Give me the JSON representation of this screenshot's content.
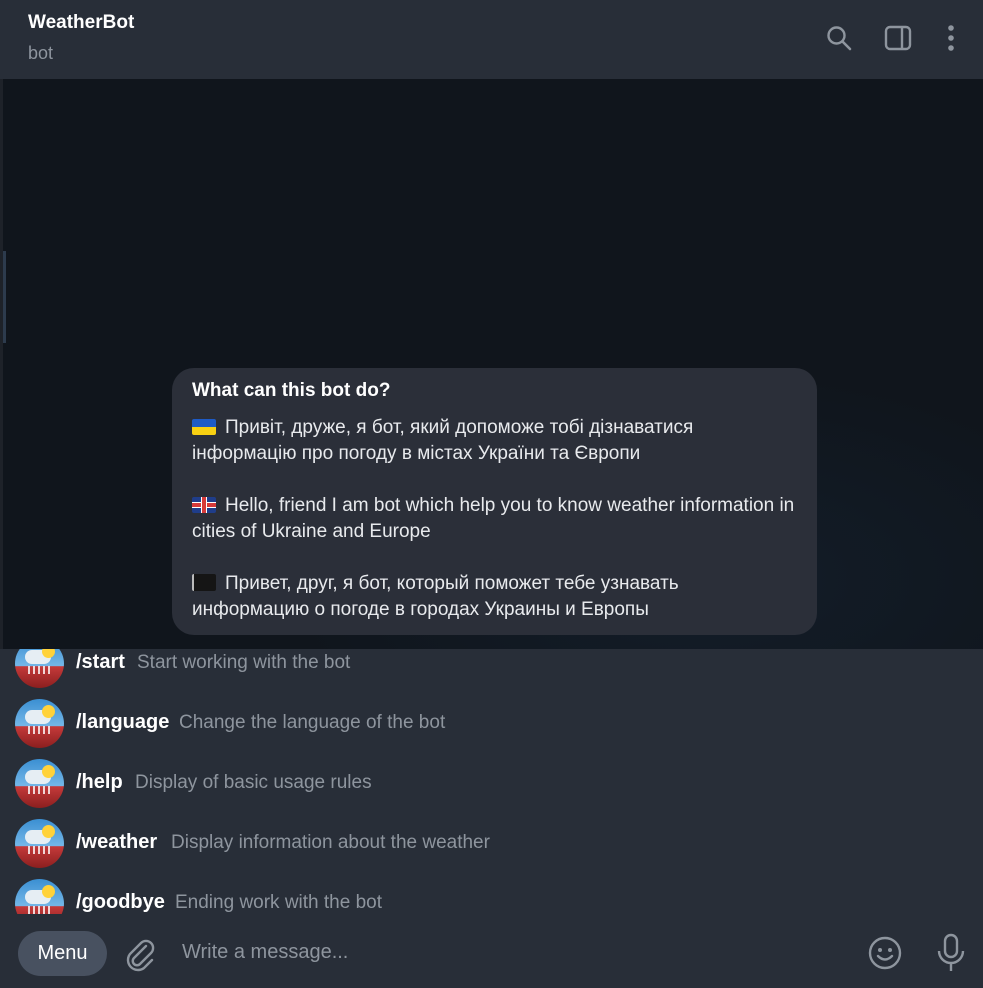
{
  "header": {
    "title": "WeatherBot",
    "subtitle": "bot",
    "icons": [
      "search-icon",
      "sidebar-toggle-icon",
      "more-vertical-icon"
    ]
  },
  "info_card": {
    "title": "What can this bot do?",
    "paragraphs": [
      {
        "flag": "ukraine-flag",
        "text": "Привіт, друже, я бот, який допоможе тобі дізнаватися інформацію про погоду в містах України та Європи"
      },
      {
        "flag": "uk-flag",
        "text": "Hello, friend I am bot which help you to know weather information in cities of Ukraine and Europe"
      },
      {
        "flag": "black-flag",
        "text": "Привет, друг, я бот, который поможет тебе узнавать информацию о погоде в городах Украины и Европы"
      }
    ]
  },
  "commands": [
    {
      "name": "/start",
      "description": "Start working with the bot"
    },
    {
      "name": "/language",
      "description": "Change the language of the bot"
    },
    {
      "name": "/help",
      "description": "Display of basic usage rules"
    },
    {
      "name": "/weather",
      "description": "Display information about the weather"
    },
    {
      "name": "/goodbye",
      "description": "Ending work with the bot"
    }
  ],
  "composer": {
    "menu_label": "Menu",
    "placeholder": "Write a message...",
    "icons": [
      "attach-icon",
      "emoji-icon",
      "microphone-icon"
    ]
  },
  "colors": {
    "header_bg": "#282e38",
    "chat_bg": "#10151c",
    "card_bg": "#2b2f39",
    "muted_text": "#8e959e",
    "menu_button": "#485160"
  }
}
